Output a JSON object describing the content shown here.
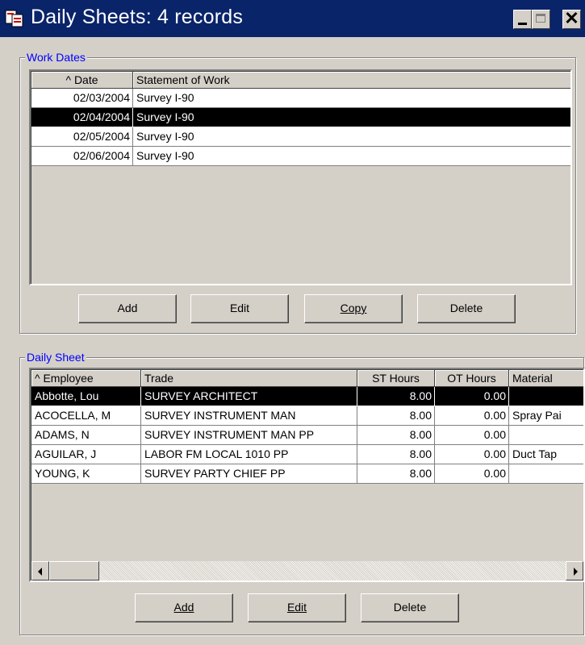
{
  "window": {
    "title": "Daily Sheets: 4 records",
    "icon": "app-sheets-icon",
    "colors": {
      "titlebar": "#0a246a",
      "group_label": "#0000ff",
      "selection": "#000000"
    }
  },
  "work_dates": {
    "group_label": "Work Dates",
    "columns": [
      "^ Date",
      "Statement of Work"
    ],
    "rows": [
      {
        "date": "02/03/2004",
        "statement": "Survey I-90",
        "selected": false
      },
      {
        "date": "02/04/2004",
        "statement": "Survey I-90",
        "selected": true
      },
      {
        "date": "02/05/2004",
        "statement": "Survey I-90",
        "selected": false
      },
      {
        "date": "02/06/2004",
        "statement": "Survey I-90",
        "selected": false
      }
    ],
    "buttons": {
      "add": "Add",
      "edit": "Edit",
      "copy": "Copy",
      "delete": "Delete"
    }
  },
  "daily_sheet": {
    "group_label": "Daily Sheet",
    "columns": [
      "^ Employee",
      "Trade",
      "ST Hours",
      "OT Hours",
      "Material"
    ],
    "rows": [
      {
        "employee": "Abbotte, Lou",
        "trade": "SURVEY ARCHITECT",
        "st": "8.00",
        "ot": "0.00",
        "material": "",
        "selected": true
      },
      {
        "employee": "ACOCELLA, M",
        "trade": "SURVEY INSTRUMENT MAN",
        "st": "8.00",
        "ot": "0.00",
        "material": "Spray Pai",
        "selected": false
      },
      {
        "employee": "ADAMS, N",
        "trade": "SURVEY INSTRUMENT MAN PP",
        "st": "8.00",
        "ot": "0.00",
        "material": "",
        "selected": false
      },
      {
        "employee": "AGUILAR, J",
        "trade": "LABOR FM LOCAL 1010 PP",
        "st": "8.00",
        "ot": "0.00",
        "material": "Duct Tap",
        "selected": false
      },
      {
        "employee": "YOUNG, K",
        "trade": "SURVEY PARTY CHIEF  PP",
        "st": "8.00",
        "ot": "0.00",
        "material": "",
        "selected": false
      }
    ],
    "buttons": {
      "add": "Add",
      "edit": "Edit",
      "delete": "Delete"
    }
  }
}
